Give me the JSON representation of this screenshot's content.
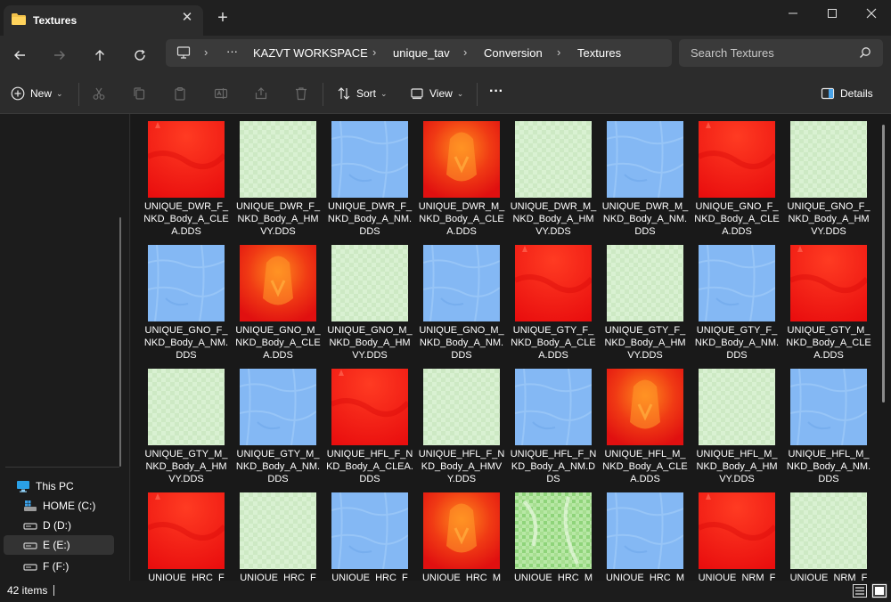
{
  "window": {
    "tab_title": "Textures",
    "new_tab": "+",
    "close_tab": "✕",
    "controls": {
      "minimize": "—",
      "maximize": "☐",
      "close": "✕"
    }
  },
  "address": {
    "overflow": "···",
    "crumbs": [
      "KAZVT WORKSPACE",
      "unique_tav",
      "Conversion",
      "Textures"
    ],
    "separator": "›",
    "search_placeholder": "Search Textures"
  },
  "commands": {
    "new": "New",
    "sort": "Sort",
    "view": "View",
    "more": "···",
    "details": "Details"
  },
  "sidebar": {
    "items": [
      {
        "label": "This PC",
        "icon": "pc-icon"
      },
      {
        "label": "HOME (C:)",
        "icon": "windows-drive-icon"
      },
      {
        "label": "D (D:)",
        "icon": "drive-icon"
      },
      {
        "label": "E (E:)",
        "icon": "drive-icon",
        "selected": true
      },
      {
        "label": "F (F:)",
        "icon": "drive-icon"
      }
    ]
  },
  "files": [
    {
      "name": "UNIQUE_DWR_F_NKD_Body_A_CLEA.DDS",
      "kind": "red"
    },
    {
      "name": "UNIQUE_DWR_F_NKD_Body_A_HMVY.DDS",
      "kind": "green"
    },
    {
      "name": "UNIQUE_DWR_F_NKD_Body_A_NM.DDS",
      "kind": "blue"
    },
    {
      "name": "UNIQUE_DWR_M_NKD_Body_A_CLEA.DDS",
      "kind": "redorange"
    },
    {
      "name": "UNIQUE_DWR_M_NKD_Body_A_HMVY.DDS",
      "kind": "green"
    },
    {
      "name": "UNIQUE_DWR_M_NKD_Body_A_NM.DDS",
      "kind": "blue"
    },
    {
      "name": "UNIQUE_GNO_F_NKD_Body_A_CLEA.DDS",
      "kind": "red"
    },
    {
      "name": "UNIQUE_GNO_F_NKD_Body_A_HMVY.DDS",
      "kind": "green"
    },
    {
      "name": "UNIQUE_GNO_F_NKD_Body_A_NM.DDS",
      "kind": "blue"
    },
    {
      "name": "UNIQUE_GNO_M_NKD_Body_A_CLEA.DDS",
      "kind": "redorange"
    },
    {
      "name": "UNIQUE_GNO_M_NKD_Body_A_HMVY.DDS",
      "kind": "green"
    },
    {
      "name": "UNIQUE_GNO_M_NKD_Body_A_NM.DDS",
      "kind": "blue"
    },
    {
      "name": "UNIQUE_GTY_F_NKD_Body_A_CLEA.DDS",
      "kind": "red"
    },
    {
      "name": "UNIQUE_GTY_F_NKD_Body_A_HMVY.DDS",
      "kind": "green"
    },
    {
      "name": "UNIQUE_GTY_F_NKD_Body_A_NM.DDS",
      "kind": "blue"
    },
    {
      "name": "UNIQUE_GTY_M_NKD_Body_A_CLEA.DDS",
      "kind": "red"
    },
    {
      "name": "UNIQUE_GTY_M_NKD_Body_A_HMVY.DDS",
      "kind": "green"
    },
    {
      "name": "UNIQUE_GTY_M_NKD_Body_A_NM.DDS",
      "kind": "blue"
    },
    {
      "name": "UNIQUE_HFL_F_NKD_Body_A_CLEA.DDS",
      "kind": "red"
    },
    {
      "name": "UNIQUE_HFL_F_NKD_Body_A_HMVY.DDS",
      "kind": "green"
    },
    {
      "name": "UNIQUE_HFL_F_NKD_Body_A_NM.DDS",
      "kind": "blue"
    },
    {
      "name": "UNIQUE_HFL_M_NKD_Body_A_CLEA.DDS",
      "kind": "redorange"
    },
    {
      "name": "UNIQUE_HFL_M_NKD_Body_A_HMVY.DDS",
      "kind": "green"
    },
    {
      "name": "UNIQUE_HFL_M_NKD_Body_A_NM.DDS",
      "kind": "blue"
    },
    {
      "name": "UNIQUE_HRC_F",
      "kind": "red"
    },
    {
      "name": "UNIQUE_HRC_F",
      "kind": "green"
    },
    {
      "name": "UNIQUE_HRC_F",
      "kind": "blue"
    },
    {
      "name": "UNIQUE_HRC_M",
      "kind": "redorange"
    },
    {
      "name": "UNIQUE_HRC_M",
      "kind": "greenstrong"
    },
    {
      "name": "UNIQUE_HRC_M",
      "kind": "blue"
    },
    {
      "name": "UNIQUE_NRM_F",
      "kind": "red"
    },
    {
      "name": "UNIQUE_NRM_F",
      "kind": "green"
    }
  ],
  "status": {
    "item_count": "42 items"
  },
  "colors": {
    "red": "#f01414",
    "blue": "#84b8f4",
    "green": "#d7efd0",
    "accent": "#4aa3e8"
  }
}
